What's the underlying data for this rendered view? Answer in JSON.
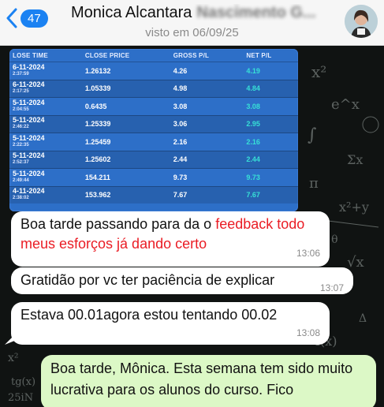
{
  "header": {
    "back_count": "47",
    "contact_name": "Monica Alcantara",
    "contact_name_blurred": "Nascimento G...",
    "last_seen": "visto em 06/09/25"
  },
  "trade_table": {
    "headers": [
      "LOSE TIME",
      "CLOSE PRICE",
      "GROSS P/L",
      "NET P/L"
    ],
    "rows": [
      {
        "date": "6-11-2024",
        "time": "2:37:59",
        "close": "1.26132",
        "gross": "4.26",
        "net": "4.19"
      },
      {
        "date": "6-11-2024",
        "time": "2:17:25",
        "close": "1.05339",
        "gross": "4.98",
        "net": "4.84"
      },
      {
        "date": "5-11-2024",
        "time": "2:04:55",
        "close": "0.6435",
        "gross": "3.08",
        "net": "3.08"
      },
      {
        "date": "5-11-2024",
        "time": "2:46:22",
        "close": "1.25339",
        "gross": "3.06",
        "net": "2.95"
      },
      {
        "date": "5-11-2024",
        "time": "2:22:35",
        "close": "1.25459",
        "gross": "2.16",
        "net": "2.16"
      },
      {
        "date": "5-11-2024",
        "time": "2:52:37",
        "close": "1.25602",
        "gross": "2.44",
        "net": "2.44"
      },
      {
        "date": "5-11-2024",
        "time": "2:49:44",
        "close": "154.211",
        "gross": "9.73",
        "net": "9.73"
      },
      {
        "date": "4-11-2024",
        "time": "2:38:02",
        "close": "153.962",
        "gross": "7.67",
        "net": "7.67"
      }
    ]
  },
  "messages": {
    "m1_part1": "Boa tarde passando para da o ",
    "m1_highlight": "feedback todo meus esforços já dando certo",
    "m1_time": "13:06",
    "m2_text": "Gratidão por vc ter paciência de explicar",
    "m2_time": "13:07",
    "m3_text": "Estava 00.01agora estou tentando 00.02",
    "m3_time": "13:08",
    "reply_text": "Boa tarde, Mônica. Esta semana tem sido muito lucrativa para os alunos do curso. Fico"
  },
  "colors": {
    "accent_blue": "#1b82f2",
    "highlight_red": "#ea1c24",
    "outgoing_bubble": "#dcf8c6",
    "net_value": "#37e0d6"
  }
}
